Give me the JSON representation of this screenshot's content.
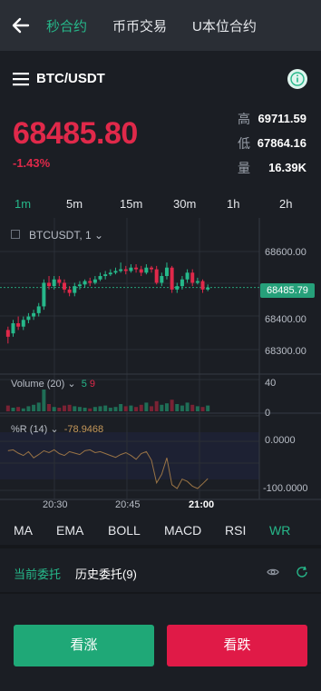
{
  "header": {
    "tabs": [
      "秒合约",
      "币币交易",
      "U本位合约"
    ],
    "active_tab": 0
  },
  "pair": {
    "name": "BTC/USDT"
  },
  "ticker": {
    "price": "68485.80",
    "change": "-1.43%",
    "stats": [
      {
        "label": "高",
        "value": "69711.59"
      },
      {
        "label": "低",
        "value": "67864.16"
      },
      {
        "label": "量",
        "value": "16.39K"
      }
    ]
  },
  "intervals": [
    "1m",
    "5m",
    "15m",
    "30m",
    "1h",
    "2h"
  ],
  "active_interval": "1m",
  "chart": {
    "symbol": "BTCUSDT, 1",
    "price_axis": [
      "68600.00",
      "68400.00",
      "68300.00"
    ],
    "current_price_tag": "68485.79",
    "volume_label": "Volume (20)",
    "volume_green": "5",
    "volume_red": "9",
    "volume_axis": [
      "40",
      "0"
    ],
    "wr_label": "%R (14)",
    "wr_value": "-78.9468",
    "wr_axis": [
      "0.0000",
      "-100.0000"
    ],
    "time_axis": [
      "20:30",
      "20:45",
      "21:00"
    ]
  },
  "chart_data": {
    "type": "candlestick",
    "symbol": "BTCUSDT",
    "interval": "1",
    "ylim": [
      68240,
      68660
    ],
    "candles": [
      [
        68360,
        68340,
        68370,
        68320
      ],
      [
        68350,
        68380,
        68390,
        68340
      ],
      [
        68380,
        68370,
        68400,
        68360
      ],
      [
        68370,
        68390,
        68400,
        68360
      ],
      [
        68390,
        68400,
        68410,
        68380
      ],
      [
        68400,
        68410,
        68420,
        68390
      ],
      [
        68410,
        68430,
        68440,
        68400
      ],
      [
        68430,
        68500,
        68510,
        68420
      ],
      [
        68500,
        68490,
        68520,
        68480
      ],
      [
        68490,
        68510,
        68520,
        68480
      ],
      [
        68510,
        68500,
        68520,
        68490
      ],
      [
        68500,
        68480,
        68510,
        68470
      ],
      [
        68480,
        68470,
        68490,
        68460
      ],
      [
        68470,
        68490,
        68500,
        68460
      ],
      [
        68490,
        68495,
        68505,
        68480
      ],
      [
        68495,
        68505,
        68510,
        68485
      ],
      [
        68505,
        68500,
        68515,
        68490
      ],
      [
        68500,
        68510,
        68520,
        68495
      ],
      [
        68510,
        68520,
        68530,
        68505
      ],
      [
        68520,
        68525,
        68535,
        68510
      ],
      [
        68525,
        68530,
        68540,
        68520
      ],
      [
        68530,
        68535,
        68545,
        68525
      ],
      [
        68535,
        68540,
        68560,
        68530
      ],
      [
        68540,
        68535,
        68550,
        68525
      ],
      [
        68535,
        68545,
        68555,
        68530
      ],
      [
        68545,
        68540,
        68555,
        68530
      ],
      [
        68540,
        68530,
        68550,
        68520
      ],
      [
        68530,
        68545,
        68555,
        68525
      ],
      [
        68545,
        68540,
        68550,
        68530
      ],
      [
        68540,
        68500,
        68550,
        68495
      ],
      [
        68500,
        68520,
        68530,
        68490
      ],
      [
        68520,
        68545,
        68560,
        68510
      ],
      [
        68545,
        68480,
        68550,
        68470
      ],
      [
        68480,
        68490,
        68500,
        68470
      ],
      [
        68490,
        68510,
        68520,
        68480
      ],
      [
        68510,
        68530,
        68540,
        68500
      ],
      [
        68530,
        68500,
        68540,
        68490
      ],
      [
        68500,
        68505,
        68515,
        68495
      ],
      [
        68505,
        68480,
        68510,
        68470
      ],
      [
        68480,
        68486,
        68495,
        68475
      ]
    ],
    "volume": [
      8,
      5,
      6,
      4,
      7,
      9,
      12,
      30,
      10,
      6,
      5,
      8,
      9,
      7,
      6,
      5,
      4,
      6,
      7,
      8,
      5,
      6,
      10,
      7,
      8,
      6,
      9,
      12,
      7,
      14,
      9,
      11,
      16,
      10,
      8,
      12,
      9,
      7,
      6,
      8
    ],
    "wr_line": [
      -20,
      -18,
      -25,
      -30,
      -22,
      -35,
      -28,
      -20,
      -24,
      -18,
      -26,
      -30,
      -22,
      -25,
      -28,
      -20,
      -18,
      -24,
      -22,
      -26,
      -30,
      -34,
      -28,
      -24,
      -30,
      -38,
      -26,
      -22,
      -40,
      -88,
      -70,
      -35,
      -92,
      -100,
      -80,
      -85,
      -95,
      -100,
      -90,
      -79
    ],
    "time_axis": [
      "20:30",
      "20:45",
      "21:00"
    ]
  },
  "indicators": [
    "MA",
    "EMA",
    "BOLL",
    "MACD",
    "RSI",
    "WR"
  ],
  "active_indicator": "WR",
  "orders": {
    "tabs": [
      "当前委托",
      "历史委托(9)"
    ],
    "active": 0
  },
  "actions": {
    "up_label": "看涨",
    "down_label": "看跌"
  },
  "colors": {
    "green": "#26b88a",
    "red": "#e0294a",
    "background": "#1b1e24"
  }
}
